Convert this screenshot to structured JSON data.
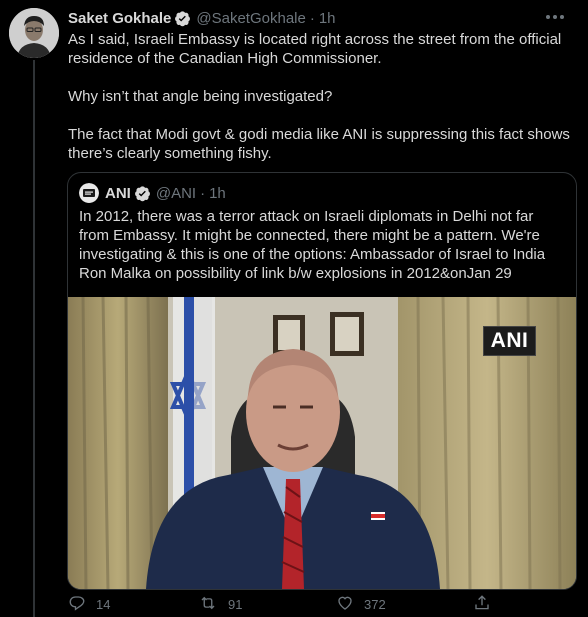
{
  "tweet": {
    "display_name": "Saket Gokhale",
    "handle": "@SaketGokhale",
    "separator": "·",
    "time": "1h",
    "paragraphs": [
      "As I said, Israeli Embassy is located right across the street from the official residence of the Canadian High Commissioner.",
      "Why isn’t that angle being investigated?",
      "The fact that Modi govt & godi media like ANI is suppressing this fact shows there’s clearly something fishy."
    ]
  },
  "quoted": {
    "display_name": "ANI",
    "handle": "@ANI",
    "separator": "·",
    "time": "1h",
    "text": "In 2012, there was a terror attack on Israeli diplomats in Delhi not far from Embassy. It might be connected, there might be a pattern. We're investigating & this is one of the options: Ambassador of Israel to India Ron Malka on possibility of link b/w explosions in 2012&onJan 29",
    "media_watermark": "ANI"
  },
  "actions": {
    "replies": "14",
    "retweets": "91",
    "likes": "372"
  },
  "icons": {
    "verified": "verified-badge-icon",
    "more": "more-options-icon",
    "reply": "reply-icon",
    "retweet": "retweet-icon",
    "like": "heart-icon",
    "share": "share-icon"
  },
  "colors": {
    "background": "#000000",
    "text_primary": "#d9d9d9",
    "text_secondary": "#6e767d",
    "border": "#2f3336",
    "verified_badge": "#d9d9d9"
  }
}
